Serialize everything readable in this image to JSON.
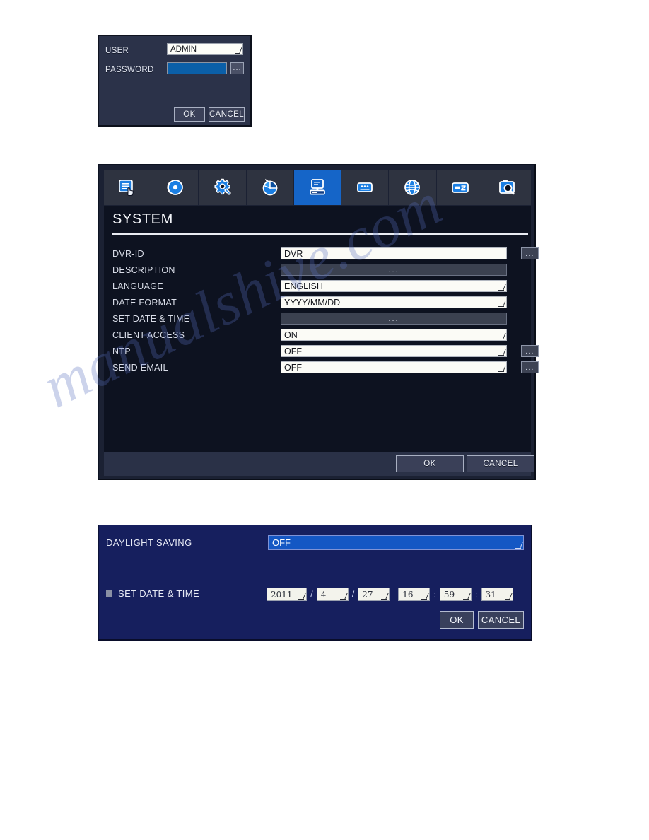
{
  "watermark": {
    "text": "manualshive.com"
  },
  "login_dialog": {
    "user_label": "USER",
    "user_value": "ADMIN",
    "password_label": "PASSWORD",
    "password_value": "",
    "password_dots_label": "...",
    "ok_label": "OK",
    "cancel_label": "CANCEL"
  },
  "system_panel": {
    "title": "SYSTEM",
    "tabs": [
      {
        "icon": "record-setup-icon",
        "label": "RECORD SETUP",
        "active": false
      },
      {
        "icon": "disc-icon",
        "label": "DISC",
        "active": false
      },
      {
        "icon": "gear-wrench-icon",
        "label": "SETUP",
        "active": false
      },
      {
        "icon": "pie-chart-icon",
        "label": "STATUS",
        "active": false
      },
      {
        "icon": "system-computer-icon",
        "label": "SYSTEM",
        "active": true
      },
      {
        "icon": "keypad-icon",
        "label": "DEVICE",
        "active": false
      },
      {
        "icon": "globe-icon",
        "label": "NETWORK",
        "active": false
      },
      {
        "icon": "backup-transfer-icon",
        "label": "BACKUP",
        "active": false
      },
      {
        "icon": "camera-search-icon",
        "label": "SEARCH",
        "active": false
      }
    ],
    "rows": [
      {
        "label": "DVR-ID",
        "value": "DVR",
        "style": "text",
        "dropdown": false,
        "ellipsis": true
      },
      {
        "label": "DESCRIPTION",
        "value": "...",
        "style": "grey",
        "dropdown": false,
        "ellipsis": false
      },
      {
        "label": "LANGUAGE",
        "value": "ENGLISH",
        "style": "text",
        "dropdown": true,
        "ellipsis": false
      },
      {
        "label": "DATE FORMAT",
        "value": "YYYY/MM/DD",
        "style": "text",
        "dropdown": true,
        "ellipsis": false
      },
      {
        "label": "SET DATE & TIME",
        "value": "...",
        "style": "grey",
        "dropdown": false,
        "ellipsis": false
      },
      {
        "label": "CLIENT ACCESS",
        "value": "ON",
        "style": "text",
        "dropdown": true,
        "ellipsis": false
      },
      {
        "label": "NTP",
        "value": "OFF",
        "style": "text",
        "dropdown": true,
        "ellipsis": true
      },
      {
        "label": "SEND EMAIL",
        "value": "OFF",
        "style": "text",
        "dropdown": true,
        "ellipsis": true
      }
    ],
    "ellipsis_label": "...",
    "ok_label": "OK",
    "cancel_label": "CANCEL"
  },
  "daylight_panel": {
    "daylight_label": "DAYLIGHT SAVING",
    "daylight_value": "OFF",
    "set_datetime_label": "SET DATE & TIME",
    "set_datetime_checked": true,
    "datetime": {
      "year": "2011",
      "month": "4",
      "day": "27",
      "hour": "16",
      "minute": "59",
      "second": "31",
      "date_separator": "/",
      "time_separator": ":"
    },
    "ok_label": "OK",
    "cancel_label": "CANCEL"
  }
}
